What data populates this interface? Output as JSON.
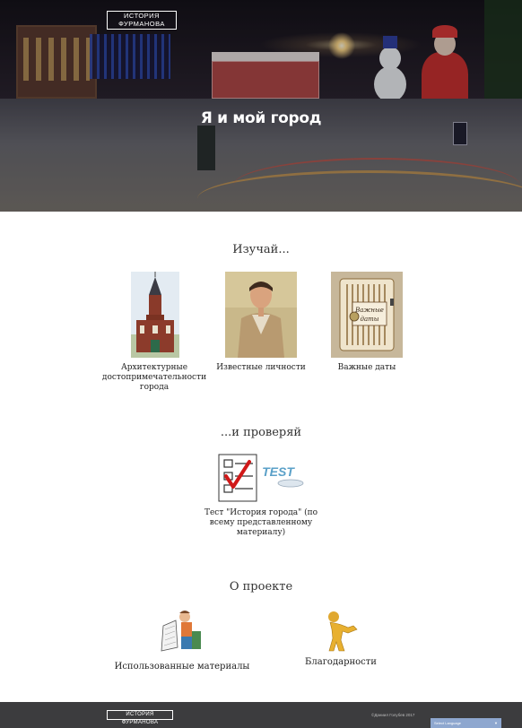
{
  "header": {
    "logo": "ИСТОРИЯ\nФУРМАНОВА",
    "logo_line1": "ИСТОРИЯ",
    "logo_line2": "ФУРМАНОВА"
  },
  "hero": {
    "title": "Я и мой город"
  },
  "learn": {
    "title": "Изучай...",
    "cards": [
      {
        "caption": "Архитектурные достопримечательности города",
        "icon": "church-photo"
      },
      {
        "caption": "Известные личности",
        "icon": "portrait-painting"
      },
      {
        "caption": "Важные даты",
        "icon": "dates-notebook"
      }
    ]
  },
  "check": {
    "title": "...и проверяй",
    "cards": [
      {
        "caption": "Тест \"История города\" (по всему представленному материалу)",
        "icon": "test-checklist"
      }
    ]
  },
  "about": {
    "title": "О проекте",
    "cards": [
      {
        "caption": "Использованные материалы",
        "icon": "reading-man"
      },
      {
        "caption": "Благодарности",
        "icon": "golden-figure"
      }
    ]
  },
  "footer": {
    "logo": "ИСТОРИЯ ФУРМАНОВА",
    "copyright": "©Даниил Голубев 2017",
    "language_select": "Select Language"
  },
  "colors": {
    "footer_bg": "#3c3c3e",
    "lang_bg": "#8ea7cf"
  }
}
